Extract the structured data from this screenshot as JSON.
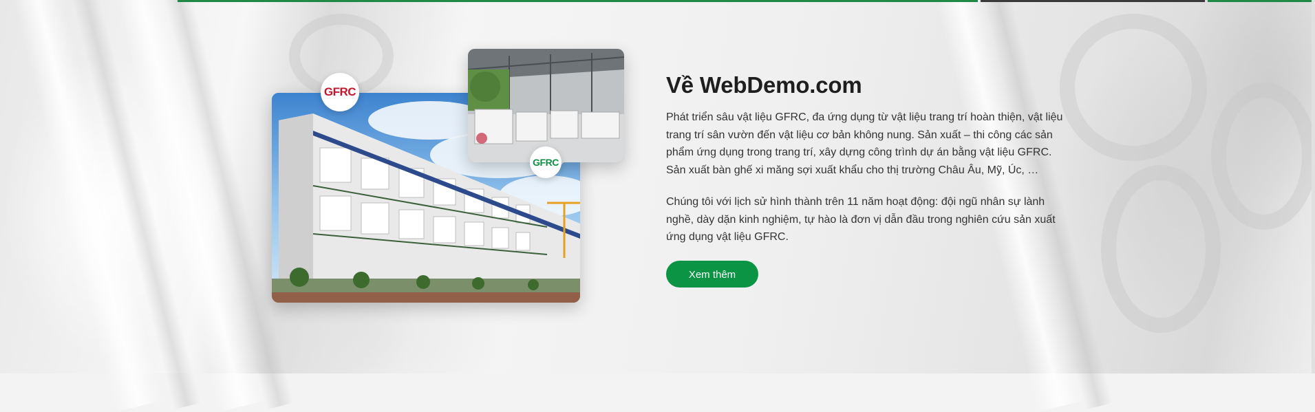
{
  "about": {
    "title": "Về WebDemo.com",
    "paragraph_1": "Phát triển sâu vật liệu GFRC, đa ứng dụng từ vật liệu trang trí hoàn thiện, vật liệu trang trí sân vườn đến vật liệu cơ bản không nung. Sản xuất – thi công các sản phẩm ứng dụng trong trang trí, xây dựng công trình dự án bằng vật liệu GFRC. Sản xuất bàn ghế xi măng sợi xuất khẩu cho thị trường Châu Âu, Mỹ, Úc, …",
    "paragraph_2": "Chúng tôi với lịch sử hình thành trên 11 năm hoạt động: đội ngũ nhân sự lành nghề, dày dặn kinh nghiệm, tự hào là đơn vị dẫn đầu trong nghiên cứu sản xuất ứng dụng vật liệu GFRC.",
    "button_label": "Xem thêm"
  },
  "badges": {
    "logo_1": "GFRC",
    "logo_2": "GFRC"
  },
  "colors": {
    "accent": "#0b9444",
    "logo_red": "#c0182c",
    "logo_green": "#0e8f43",
    "heading": "#1e1e1e",
    "text": "#333333"
  }
}
